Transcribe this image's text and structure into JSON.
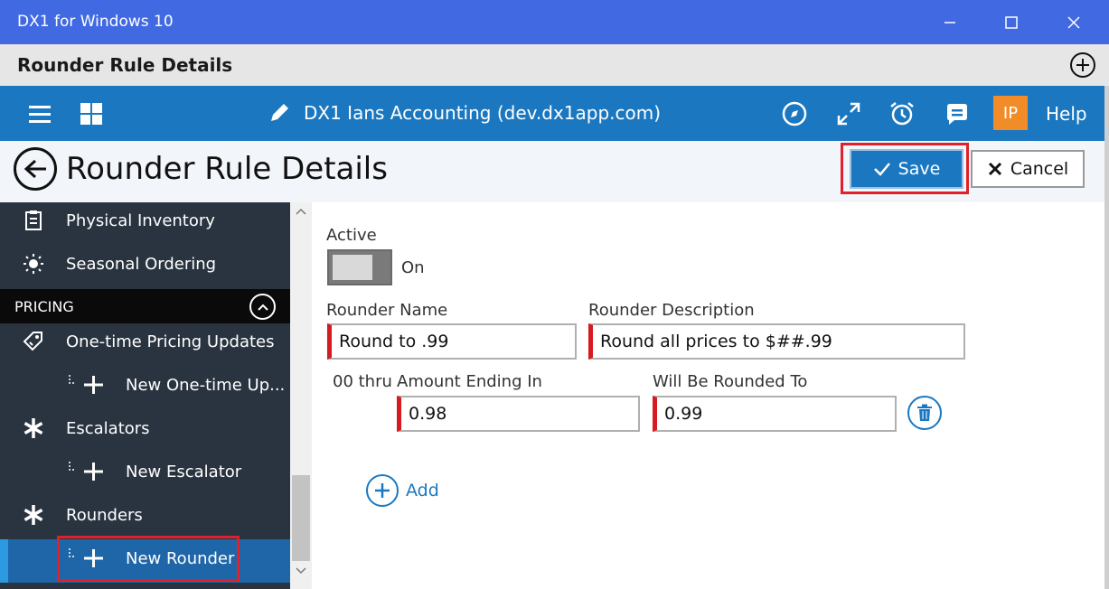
{
  "window": {
    "title": "DX1 for Windows 10",
    "minimize_glyph": "—",
    "maximize_glyph": "☐",
    "close_glyph": "✕"
  },
  "pagebar": {
    "title": "Rounder Rule Details"
  },
  "navbar": {
    "company": "DX1 Ians Accounting (dev.dx1app.com)",
    "avatar_initials": "IP",
    "help_label": "Help",
    "icons": [
      "menu-icon",
      "grid-icon",
      "pencil-icon",
      "compass-icon",
      "expand-icon",
      "alarm-icon",
      "chat-icon"
    ]
  },
  "detail": {
    "title": "Rounder Rule Details",
    "save_label": "Save",
    "cancel_label": "Cancel"
  },
  "sidebar": {
    "items": [
      {
        "label": "Physical Inventory",
        "icon": "clipboard-icon"
      },
      {
        "label": "Seasonal Ordering",
        "icon": "sun-icon"
      },
      {
        "label": "One-time Pricing Updates",
        "icon": "price-tag-icon"
      },
      {
        "label": "New One-time Up...",
        "icon": "plus-icon"
      },
      {
        "label": "Escalators",
        "icon": "asterisk-icon"
      },
      {
        "label": "New Escalator",
        "icon": "plus-icon"
      },
      {
        "label": "Rounders",
        "icon": "asterisk-icon"
      },
      {
        "label": "New Rounder",
        "icon": "plus-icon"
      }
    ],
    "section_label": "PRICING"
  },
  "form": {
    "active_label": "Active",
    "active_state": "On",
    "name_label": "Rounder Name",
    "name_value": "Round to .99",
    "desc_label": "Rounder Description",
    "desc_value": "Round all prices to $##.99",
    "range_prefix": "00 thru",
    "ending_label": "Amount Ending In",
    "ending_value": "0.98",
    "rounded_label": "Will Be Rounded To",
    "rounded_value": "0.99",
    "add_label": "Add"
  },
  "colors": {
    "titlebar": "#4169e1",
    "navbar": "#1b78c0",
    "sidebar": "#2a3440",
    "required": "#d71920",
    "highlight": "#e0202a",
    "avatar": "#f28c28"
  }
}
